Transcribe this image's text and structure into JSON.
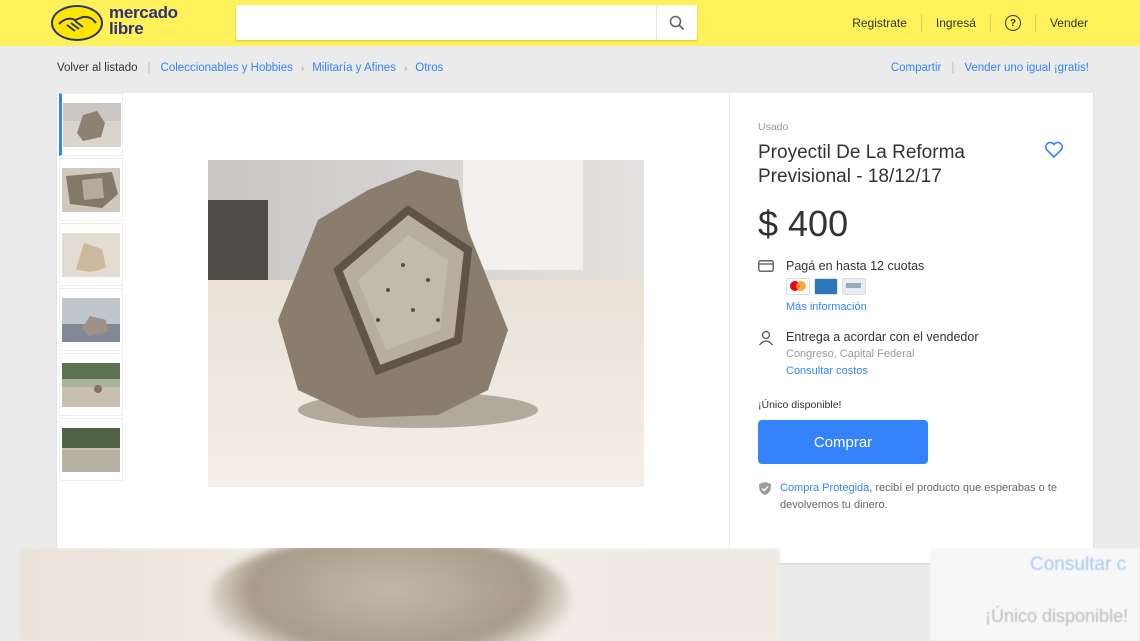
{
  "header": {
    "logo_line1": "mercado",
    "logo_line2": "libre",
    "search_placeholder": "",
    "links": {
      "register": "Registrate",
      "login": "Ingresá",
      "help": "?",
      "sell": "Vender"
    }
  },
  "breadcrumb": {
    "back": "Volver al listado",
    "items": [
      "Coleccionables y Hobbies",
      "Militaría y Afines",
      "Otros"
    ],
    "right": {
      "share": "Compartir",
      "sell_same": "Vender uno igual ¡gratis!"
    }
  },
  "product": {
    "condition": "Usado",
    "title": "Proyectil De La Reforma Previsional - 18/12/17",
    "price": "$ 400",
    "installments": "Pagá en hasta 12 cuotas",
    "more_info": "Más información",
    "delivery": "Entrega a acordar con el vendedor",
    "location": "Congreso, Capital Federal",
    "check_costs": "Consultar costos",
    "stock": "¡Único disponible!",
    "buy_label": "Comprar",
    "protect_link": "Compra Protegida",
    "protect_text": ", recibí el producto que esperabas o te devolvemos tu dinero."
  },
  "overlay": {
    "button_ghost": "Consultar c",
    "stock_ghost": "¡Único disponible!"
  },
  "colors": {
    "brand_yellow": "#fff159",
    "accent_blue": "#3483fa"
  }
}
